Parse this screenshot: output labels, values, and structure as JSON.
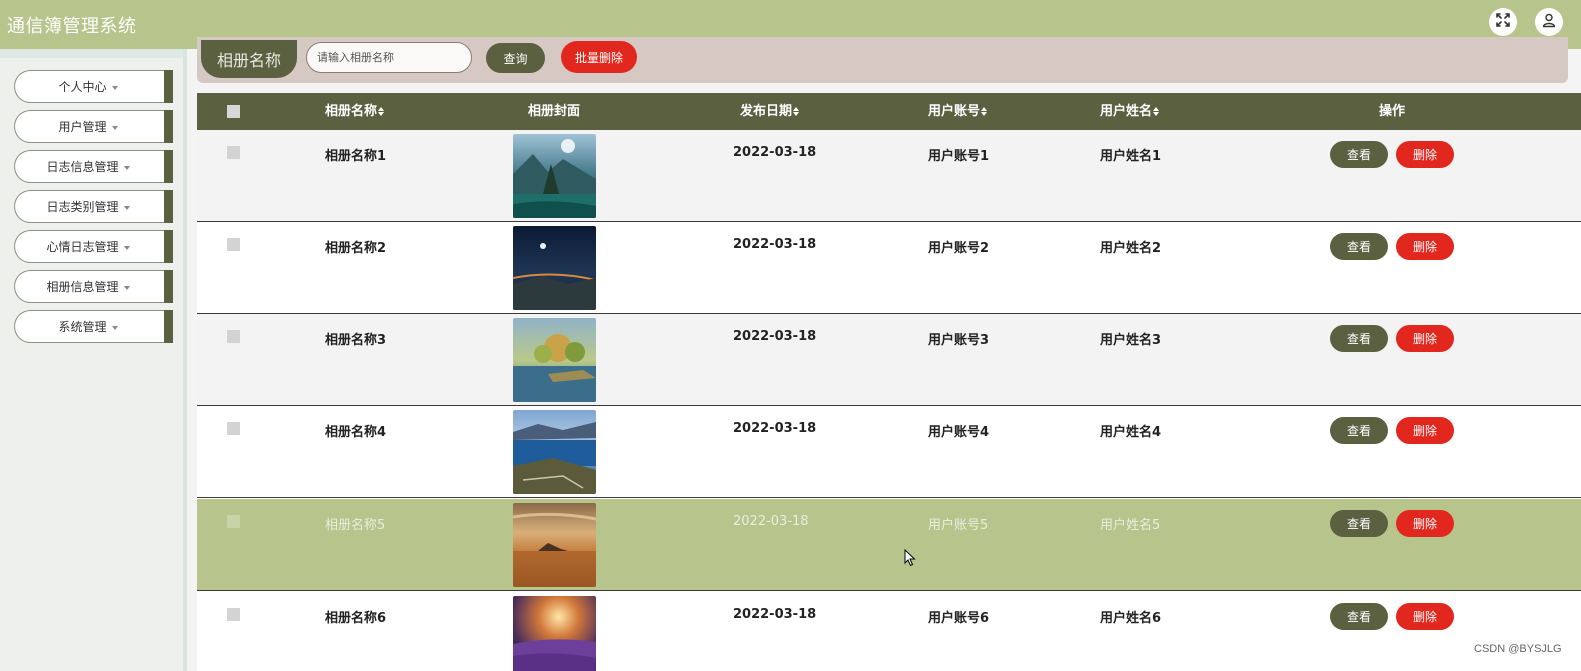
{
  "header": {
    "app_title": "通信簿管理系统",
    "fullscreen_icon": "expand-arrows-icon",
    "user_icon": "user-icon"
  },
  "sidebar": {
    "items": [
      {
        "label": "个人中心"
      },
      {
        "label": "用户管理"
      },
      {
        "label": "日志信息管理"
      },
      {
        "label": "日志类别管理"
      },
      {
        "label": "心情日志管理"
      },
      {
        "label": "相册信息管理"
      },
      {
        "label": "系统管理"
      }
    ]
  },
  "search": {
    "field_label": "相册名称",
    "placeholder": "请输入相册名称",
    "value": "",
    "query_label": "查询",
    "batch_delete_label": "批量删除"
  },
  "table": {
    "headers": {
      "name": "相册名称",
      "cover": "相册封面",
      "date": "发布日期",
      "account": "用户账号",
      "username": "用户姓名",
      "actions": "操作"
    },
    "view_label": "查看",
    "delete_label": "删除",
    "rows": [
      {
        "name": "相册名称1",
        "date": "2022-03-18",
        "account": "用户账号1",
        "username": "用户姓名1",
        "cover": "mountain-lake-image",
        "highlighted": false
      },
      {
        "name": "相册名称2",
        "date": "2022-03-18",
        "account": "用户账号2",
        "username": "用户姓名2",
        "cover": "night-sky-image",
        "highlighted": false
      },
      {
        "name": "相册名称3",
        "date": "2022-03-18",
        "account": "用户账号3",
        "username": "用户姓名3",
        "cover": "autumn-lake-image",
        "highlighted": false
      },
      {
        "name": "相册名称4",
        "date": "2022-03-18",
        "account": "用户账号4",
        "username": "用户姓名4",
        "cover": "blue-lake-image",
        "highlighted": false
      },
      {
        "name": "相册名称5",
        "date": "2022-03-18",
        "account": "用户账号5",
        "username": "用户姓名5",
        "cover": "sunset-sea-image",
        "highlighted": true
      },
      {
        "name": "相册名称6",
        "date": "2022-03-18",
        "account": "用户账号6",
        "username": "用户姓名6",
        "cover": "lavender-field-image",
        "highlighted": false
      }
    ]
  },
  "watermark": "CSDN @BYSJLG",
  "colors": {
    "header": "#b7c48c",
    "accent_dark": "#5a6040",
    "danger": "#e2281e",
    "search_bg": "#d6c8c2",
    "highlight_row": "#b7c48c"
  }
}
